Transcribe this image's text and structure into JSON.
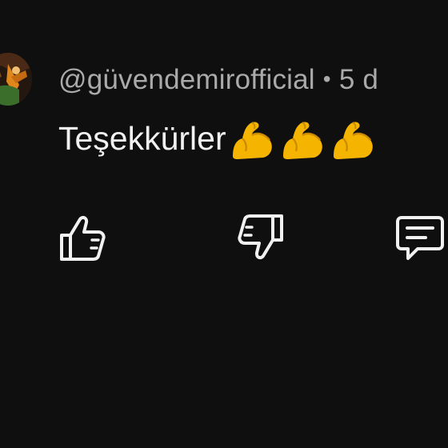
{
  "comment": {
    "author": "@güvendemirofficial",
    "separator": "•",
    "time": "5 d",
    "text": "Teşekkürler",
    "emoji": [
      "flexed-biceps",
      "flexed-biceps",
      "flexed-biceps"
    ]
  },
  "actions": {
    "like_icon": "thumbs-up-icon",
    "dislike_icon": "thumbs-down-icon",
    "reply_icon": "reply-comment-icon"
  },
  "colors": {
    "background": "#0f0f0f",
    "text_primary": "#f1f1f1",
    "text_secondary": "#aaaaaa",
    "emoji_yellow": "#f5b400"
  }
}
